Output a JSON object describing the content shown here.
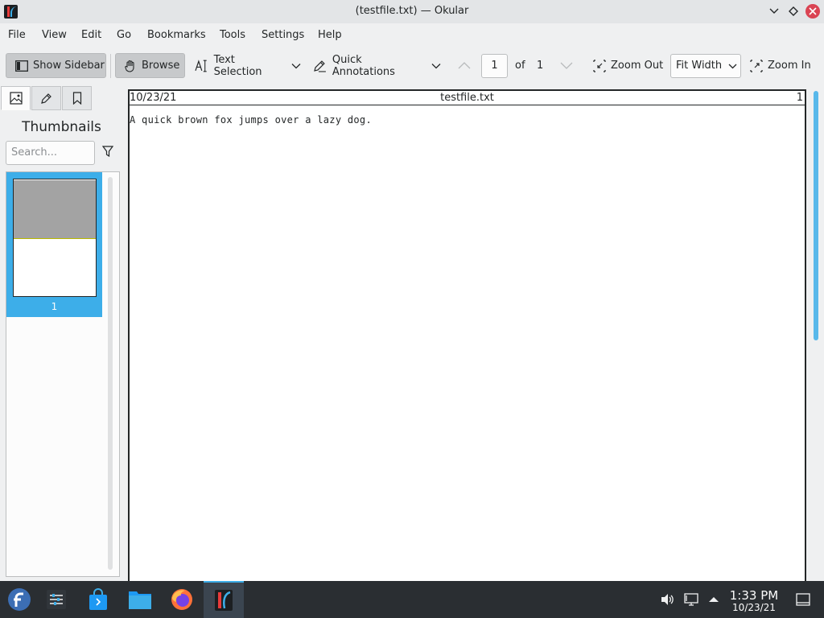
{
  "window": {
    "title": "(testfile.txt) — Okular"
  },
  "menu": [
    "File",
    "View",
    "Edit",
    "Go",
    "Bookmarks",
    "Tools",
    "Settings",
    "Help"
  ],
  "toolbar": {
    "show_sidebar": "Show Sidebar",
    "browse": "Browse",
    "text_selection": "Text Selection",
    "quick_annotations": "Quick Annotations",
    "page_current": "1",
    "page_of": "of",
    "page_total": "1",
    "zoom_out": "Zoom Out",
    "zoom_mode": "Fit Width",
    "zoom_in": "Zoom In"
  },
  "sidebar": {
    "title": "Thumbnails",
    "search_placeholder": "Search...",
    "thumbnail_label": "1"
  },
  "document": {
    "header_date": "10/23/21",
    "header_filename": "testfile.txt",
    "header_page": "1",
    "body_text": "A quick brown fox jumps over a lazy dog."
  },
  "taskbar": {
    "time": "1:33 PM",
    "date": "10/23/21"
  },
  "colors": {
    "accent": "#3daee9",
    "close": "#da4453",
    "taskbar": "#2a2e32"
  }
}
